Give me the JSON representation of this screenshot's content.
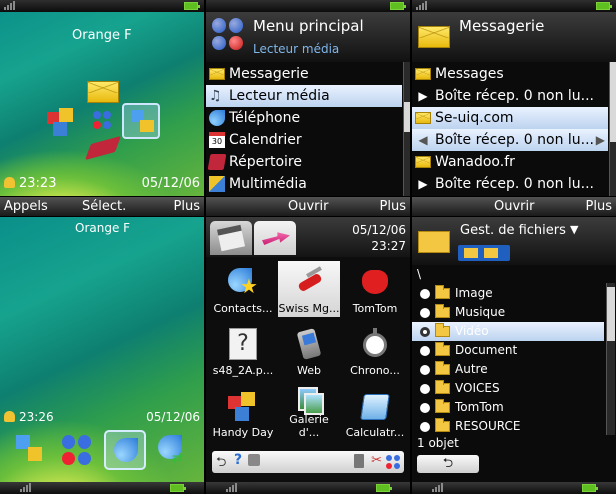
{
  "softkeys": {
    "s1": {
      "left": "Appels",
      "center": "Sélect.",
      "right": "Plus"
    },
    "s2": {
      "center": "Ouvrir",
      "right": "Plus"
    },
    "s3": {
      "center": "Ouvrir",
      "right": "Plus"
    }
  },
  "home1": {
    "operator": "Orange F",
    "time": "23:23",
    "date": "05/12/06"
  },
  "home2": {
    "operator": "Orange F",
    "time": "23:26",
    "date": "05/12/06"
  },
  "menu": {
    "title": "Menu principal",
    "subtitle": "Lecteur média",
    "items": [
      "Messagerie",
      "Lecteur média",
      "Téléphone",
      "Calendrier",
      "Répertoire",
      "Multimédia"
    ],
    "selected": "Lecteur média"
  },
  "messaging": {
    "title": "Messagerie",
    "rows": [
      "Messages",
      "Boîte récep. 0 non lu...",
      "Se-uiq.com",
      "Boîte récep. 0 non lu...",
      "Wanadoo.fr",
      "Boîte récep. 0 non lu..."
    ]
  },
  "apps": {
    "date": "05/12/06",
    "time": "23:27",
    "items": [
      "Contacts...",
      "Swiss Mg...",
      "TomTom",
      "s48_2A.p...",
      "Web",
      "Chrono...",
      "Handy Day",
      "Galerie d'...",
      "Calculatr..."
    ],
    "selected": "Swiss Mg..."
  },
  "files": {
    "title": "Gest. de fichiers",
    "path": "\\",
    "folders": [
      "Image",
      "Musique",
      "Vidéo",
      "Document",
      "Autre",
      "VOICES",
      "TomTom",
      "RESOURCE"
    ],
    "selected": "Vidéo",
    "count": "1 objet"
  },
  "colors": {
    "highlight": "#c9dcf4",
    "softkey": "#2b2b2b",
    "battery": "#5fbf20",
    "accent": "#e8c21a"
  }
}
